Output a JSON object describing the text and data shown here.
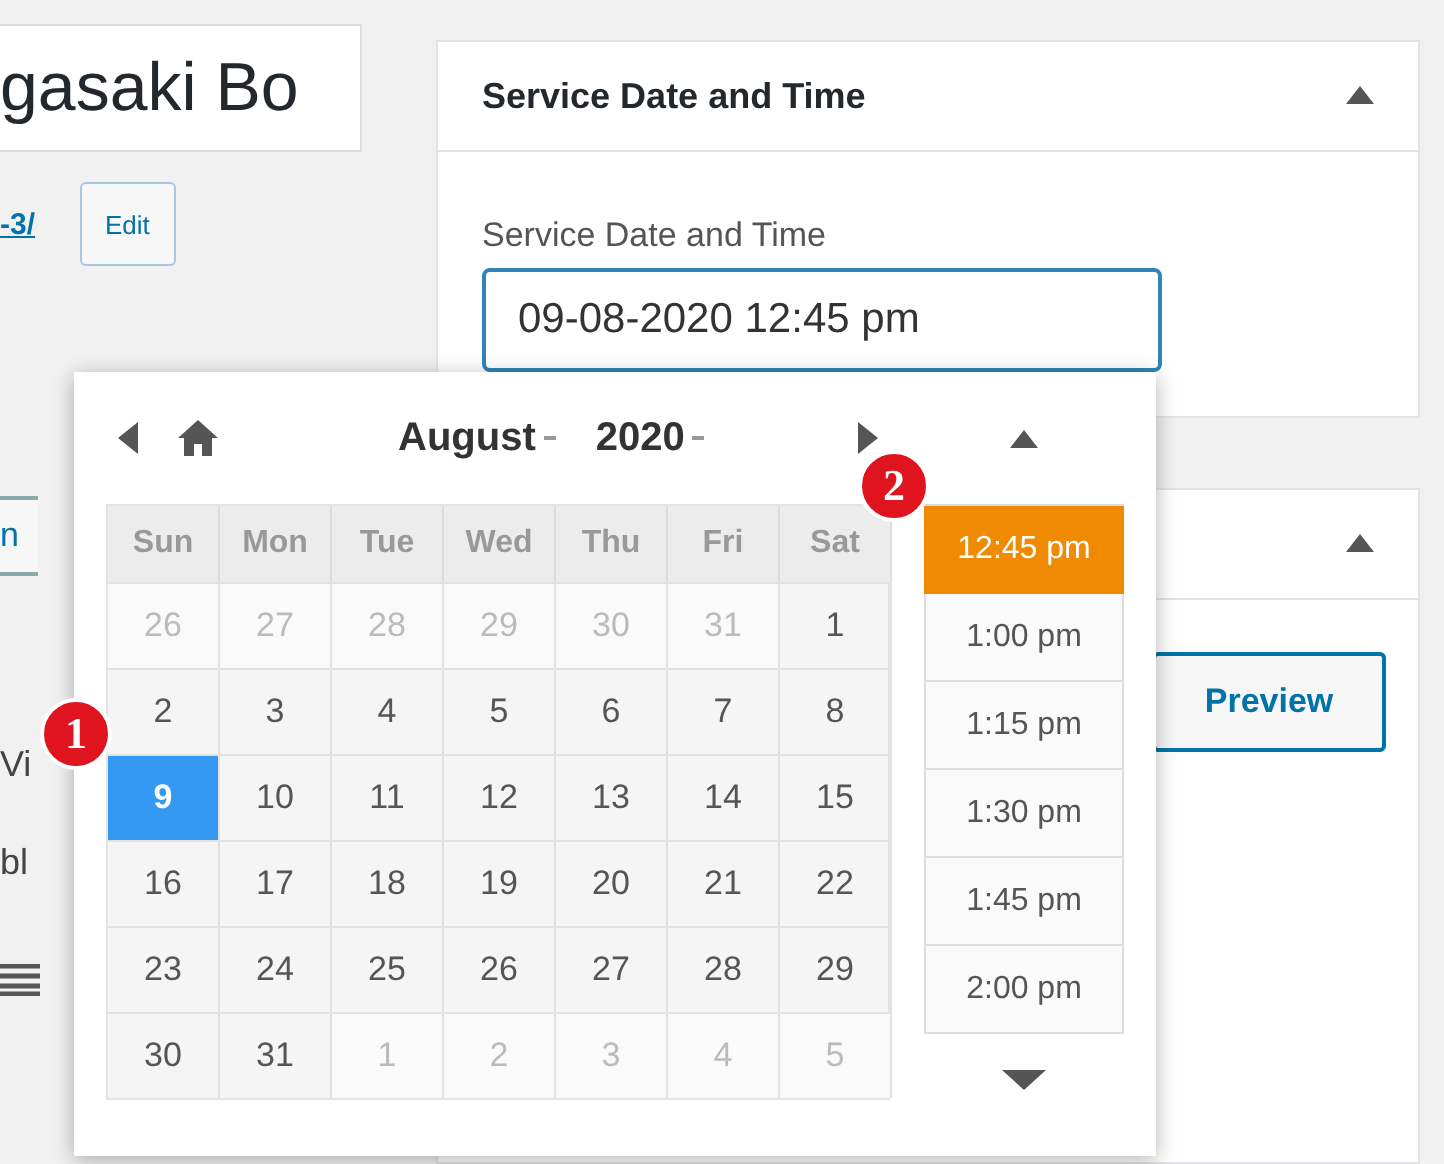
{
  "title_field": {
    "value": "gasaki Bo"
  },
  "permalink": {
    "link": "-3/",
    "edit_button": "Edit"
  },
  "left_fragments": [
    {
      "kind": "button",
      "text": "n"
    },
    {
      "kind": "text",
      "text": "Vi"
    },
    {
      "kind": "text",
      "text": "bl"
    },
    {
      "kind": "icon"
    }
  ],
  "service_panel": {
    "title": "Service Date and Time",
    "expanded": true,
    "field_label": "Service Date and Time",
    "field_value": "09-08-2020 12:45 pm"
  },
  "second_panel": {
    "expanded": true,
    "button": "Preview"
  },
  "picker": {
    "month": "August",
    "year": "2020",
    "weekdays": [
      "Sun",
      "Mon",
      "Tue",
      "Wed",
      "Thu",
      "Fri",
      "Sat"
    ],
    "days": [
      {
        "day": "26",
        "other_month": true,
        "selected": false
      },
      {
        "day": "27",
        "other_month": true,
        "selected": false
      },
      {
        "day": "28",
        "other_month": true,
        "selected": false
      },
      {
        "day": "29",
        "other_month": true,
        "selected": false
      },
      {
        "day": "30",
        "other_month": true,
        "selected": false
      },
      {
        "day": "31",
        "other_month": true,
        "selected": false
      },
      {
        "day": "1",
        "other_month": false,
        "selected": false
      },
      {
        "day": "2",
        "other_month": false,
        "selected": false
      },
      {
        "day": "3",
        "other_month": false,
        "selected": false
      },
      {
        "day": "4",
        "other_month": false,
        "selected": false
      },
      {
        "day": "5",
        "other_month": false,
        "selected": false
      },
      {
        "day": "6",
        "other_month": false,
        "selected": false
      },
      {
        "day": "7",
        "other_month": false,
        "selected": false
      },
      {
        "day": "8",
        "other_month": false,
        "selected": false
      },
      {
        "day": "9",
        "other_month": false,
        "selected": true
      },
      {
        "day": "10",
        "other_month": false,
        "selected": false
      },
      {
        "day": "11",
        "other_month": false,
        "selected": false
      },
      {
        "day": "12",
        "other_month": false,
        "selected": false
      },
      {
        "day": "13",
        "other_month": false,
        "selected": false
      },
      {
        "day": "14",
        "other_month": false,
        "selected": false
      },
      {
        "day": "15",
        "other_month": false,
        "selected": false
      },
      {
        "day": "16",
        "other_month": false,
        "selected": false
      },
      {
        "day": "17",
        "other_month": false,
        "selected": false
      },
      {
        "day": "18",
        "other_month": false,
        "selected": false
      },
      {
        "day": "19",
        "other_month": false,
        "selected": false
      },
      {
        "day": "20",
        "other_month": false,
        "selected": false
      },
      {
        "day": "21",
        "other_month": false,
        "selected": false
      },
      {
        "day": "22",
        "other_month": false,
        "selected": false
      },
      {
        "day": "23",
        "other_month": false,
        "selected": false
      },
      {
        "day": "24",
        "other_month": false,
        "selected": false
      },
      {
        "day": "25",
        "other_month": false,
        "selected": false
      },
      {
        "day": "26",
        "other_month": false,
        "selected": false
      },
      {
        "day": "27",
        "other_month": false,
        "selected": false
      },
      {
        "day": "28",
        "other_month": false,
        "selected": false
      },
      {
        "day": "29",
        "other_month": false,
        "selected": false
      },
      {
        "day": "30",
        "other_month": false,
        "selected": false
      },
      {
        "day": "31",
        "other_month": false,
        "selected": false
      },
      {
        "day": "1",
        "other_month": true,
        "selected": false
      },
      {
        "day": "2",
        "other_month": true,
        "selected": false
      },
      {
        "day": "3",
        "other_month": true,
        "selected": false
      },
      {
        "day": "4",
        "other_month": true,
        "selected": false
      },
      {
        "day": "5",
        "other_month": true,
        "selected": false
      }
    ],
    "times": [
      {
        "label": "12:45 pm",
        "selected": true
      },
      {
        "label": "1:00 pm",
        "selected": false
      },
      {
        "label": "1:15 pm",
        "selected": false
      },
      {
        "label": "1:30 pm",
        "selected": false
      },
      {
        "label": "1:45 pm",
        "selected": false
      },
      {
        "label": "2:00 pm",
        "selected": false
      }
    ]
  },
  "badges": [
    {
      "text": "1"
    },
    {
      "text": "2"
    }
  ]
}
